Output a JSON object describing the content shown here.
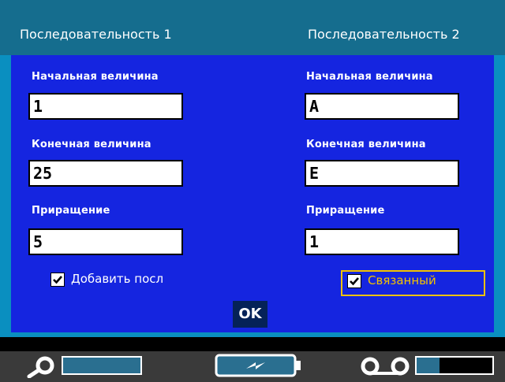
{
  "title": {
    "left": "Последовательность 1",
    "right": "Последовательность 2"
  },
  "sequence1": {
    "start_label": "Начальная величина",
    "start_value": "1",
    "end_label": "Конечная величина",
    "end_value": "25",
    "increment_label": "Приращение",
    "increment_value": "5",
    "add_checkbox_label": "Добавить посл",
    "add_checked": true
  },
  "sequence2": {
    "start_label": "Начальная величина",
    "start_value": "A",
    "end_label": "Конечная величина",
    "end_value": "E",
    "increment_label": "Приращение",
    "increment_value": "1",
    "linked_checkbox_label": "Связанный",
    "linked_checked": true
  },
  "ok_label": "OK",
  "status": {
    "search_icon": "search-icon",
    "battery_icon": "battery-charging-icon",
    "tape_icon": "tape-reel-icon",
    "tape_level": 0.3
  },
  "colors": {
    "panel": "#1525e0",
    "titlebar": "#156d8e",
    "frame": "#0a8fc0",
    "linked_text": "#f2c200"
  }
}
